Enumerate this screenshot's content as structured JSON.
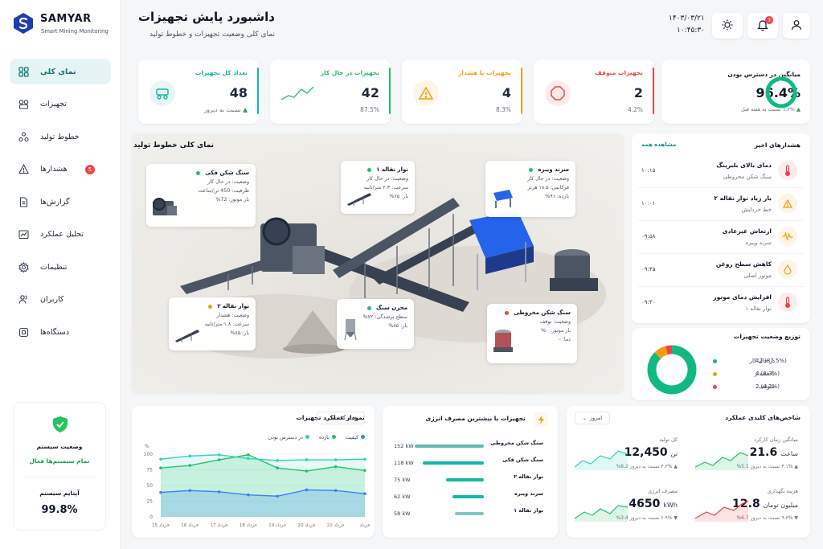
{
  "brand": {
    "name": "SAMYAR",
    "tagline": "Smart Mining Monitoring"
  },
  "header": {
    "title": "داشبورد پایش تجهیزات",
    "subtitle": "نمای کلی وضعیت تجهیزات و خطوط تولید",
    "date": "۱۴۰۳/۰۳/۲۱",
    "time": "۱۰:۴۵:۳۰",
    "notif_count": "3"
  },
  "nav": [
    {
      "label": "نمای کلی",
      "icon": "grid-icon",
      "active": true
    },
    {
      "label": "تجهیزات",
      "icon": "equipment-icon"
    },
    {
      "label": "خطوط تولید",
      "icon": "production-lines-icon"
    },
    {
      "label": "هشدارها",
      "icon": "warning-icon",
      "badge": "5"
    },
    {
      "label": "گزارش‌ها",
      "icon": "report-icon"
    },
    {
      "label": "تحلیل عملکرد",
      "icon": "analytics-icon"
    },
    {
      "label": "تنظیمات",
      "icon": "gear-icon"
    },
    {
      "label": "کاربران",
      "icon": "users-icon"
    },
    {
      "label": "دستگاه‌ها",
      "icon": "devices-icon"
    }
  ],
  "system": {
    "status_label": "وضعیت سیستم",
    "status_value": "تمام سیستم‌ها فعال",
    "uptime_label": "آپتایم سیستم",
    "uptime_value": "99.8%"
  },
  "kpis": [
    {
      "title": "تعداد کل تجهیزات",
      "value": "48",
      "sub": "نسبت به دیروز",
      "color": "#14b8a6"
    },
    {
      "title": "تجهیزات در حال کار",
      "value": "42",
      "sub": "87.5%",
      "color": "#22c55e"
    },
    {
      "title": "تجهیزات با هشدار",
      "value": "4",
      "sub": "8.3%",
      "color": "#f59e0b"
    },
    {
      "title": "تجهیزات متوقف",
      "value": "2",
      "sub": "4.2%",
      "color": "#ef4444"
    }
  ],
  "availability": {
    "title": "میانگین در دسترس بودن",
    "value": "96.4%",
    "sub": "۱.۲% نسبت به هفته قبل",
    "percent": 96.4
  },
  "overview": {
    "title": "نمای کلی خطوط تولید",
    "popups": [
      {
        "name": "سنگ شکن فکی",
        "status": "وضعیت: در حال کار",
        "l2": "ظرفیت: 450 تن/ساعت",
        "l3": "بار موتور: 72%",
        "color": "#22c55e"
      },
      {
        "name": "نوار نقاله ۱",
        "status": "وضعیت: در حال کار",
        "l2": "سرعت: ۲.۳ متر/ثانیه",
        "l3": "بار: ۶۵%",
        "color": "#22c55e"
      },
      {
        "name": "سرند ویبره",
        "status": "وضعیت: در حال کار",
        "l2": "فرکانس: ۱۸.۵ هرتز",
        "l3": "بازده: ۹۱%",
        "color": "#22c55e"
      },
      {
        "name": "نوار نقاله ۲",
        "status": "وضعیت: هشدار",
        "l2": "سرعت: ۱.۸ متر/ثانیه",
        "l3": "بار: ۸۵%",
        "color": "#f59e0b"
      },
      {
        "name": "مخزن سنگ",
        "status": "",
        "l2": "سطح پرشدگی: ۷۲%",
        "l3": "بار: ۸۵%",
        "color": "#22c55e"
      },
      {
        "name": "سنگ شکن مخروطی",
        "status": "وضعیت: توقف",
        "l2": "بار موتور: ۰%",
        "l3": "دما: -",
        "color": "#ef4444"
      }
    ]
  },
  "alerts": {
    "title": "هشدارهای اخیر",
    "see_all": "مشاهده همه",
    "items": [
      {
        "title": "دمای بالای بلبرینگ",
        "sub": "سنگ شکن مخروطی",
        "time": "۱۰:۱۵",
        "icon": "thermometer-icon",
        "color": "#ef4444",
        "bg": "#fdecec"
      },
      {
        "title": "بار زیاد نوار نقاله ۲",
        "sub": "خط خردایش",
        "time": "۱۰:۰۱",
        "icon": "warning-icon",
        "color": "#f59e0b",
        "bg": "#fef5e6"
      },
      {
        "title": "ارتعاش غیرعادی",
        "sub": "سرند ویبره",
        "time": "۰۹:۵۸",
        "icon": "vibration-icon",
        "color": "#f59e0b",
        "bg": "#fef5e6"
      },
      {
        "title": "کاهش سطح روغن",
        "sub": "موتور اصلی",
        "time": "۰۹:۴۵",
        "icon": "oil-drop-icon",
        "color": "#f59e0b",
        "bg": "#fef5e6"
      },
      {
        "title": "افزایش دمای موتور",
        "sub": "نوار نقاله ۱",
        "time": "۰۹:۳۰",
        "icon": "thermometer-icon",
        "color": "#ef4444",
        "bg": "#fdecec"
      }
    ]
  },
  "distribution": {
    "title": "توزیع وضعیت تجهیزات",
    "items": [
      {
        "label": "در حال کار",
        "value": "42 (87.5%)",
        "color": "#10b981",
        "pct": 87.5
      },
      {
        "label": "با هشدار",
        "value": "4 (8.3%)",
        "color": "#f59e0b",
        "pct": 8.3
      },
      {
        "label": "متوقف",
        "value": "2 (4.2%)",
        "color": "#ef4444",
        "pct": 4.2
      }
    ]
  },
  "performance": {
    "title": "نمودار عملکرد تجهیزات",
    "dropdown": "هفته گذشته",
    "yunit": "%"
  },
  "chart_data": {
    "type": "line",
    "title": "نمودار عملکرد تجهیزات",
    "categories": [
      "15 خرداد",
      "16 خرداد",
      "17 خرداد",
      "18 خرداد",
      "19 خرداد",
      "20 خرداد",
      "21 خرداد",
      "خرداد"
    ],
    "yticks": [
      "0",
      "25",
      "50",
      "75",
      "100"
    ],
    "ylim": [
      0,
      100
    ],
    "series": [
      {
        "name": "کیفیت",
        "color": "#3b82f6",
        "values": [
          39,
          42,
          40,
          35,
          33,
          43,
          42,
          37
        ]
      },
      {
        "name": "بازده",
        "color": "#22c55e",
        "values": [
          78,
          82,
          91,
          99,
          78,
          73,
          80,
          74
        ]
      },
      {
        "name": "در دسترس بودن",
        "color": "#2dd4bf",
        "values": [
          92,
          97,
          99,
          93,
          90,
          91,
          91,
          92
        ]
      }
    ]
  },
  "energy": {
    "title": "تجهیزات با بیشترین مصرف انرژی",
    "items": [
      {
        "name": "سنگ شکن مخروطی",
        "value": "152 kW",
        "pct": 100,
        "color": "#5fb8b8"
      },
      {
        "name": "سنگ شکن فکی",
        "value": "118 kW",
        "pct": 88,
        "color": "#14b8a6"
      },
      {
        "name": "نوار نقاله ۲",
        "value": "75 kW",
        "pct": 55,
        "color": "#14b8a6"
      },
      {
        "name": "سرند ویبره",
        "value": "62 kW",
        "pct": 45,
        "color": "#14b8a6"
      },
      {
        "name": "نوار نقاله ۱",
        "value": "58 kW",
        "pct": 42,
        "color": "#7fc7c7"
      }
    ]
  },
  "kpi_panel": {
    "title": "شاخص‌های کلیدی عملکرد",
    "dropdown": "امروز",
    "items": [
      {
        "title": "میانگین زمان کارکرد",
        "value": "21.6",
        "unit": "ساعت",
        "change": "▲ ۴.۱% نسبت به دیروز 5.1%",
        "color": "#22c55e"
      },
      {
        "title": "کل تولید",
        "value": "12,450",
        "unit": "تن",
        "change": "▲ ۴.۳% نسبت به دیروز 8.2%",
        "color": "#2dd4bf"
      },
      {
        "title": "هزینه نگهداری",
        "value": "12.8",
        "unit": "میلیون تومان",
        "change": "▼ ۹.۳% نسبت به دیروز 6.7%",
        "color": "#ef4444"
      },
      {
        "title": "مصرف انرژی",
        "value": "4650",
        "unit": "kWh",
        "change": "▼ ۶.۹% نسبت به دیروز 3.4%",
        "color": "#22c55e"
      }
    ]
  }
}
